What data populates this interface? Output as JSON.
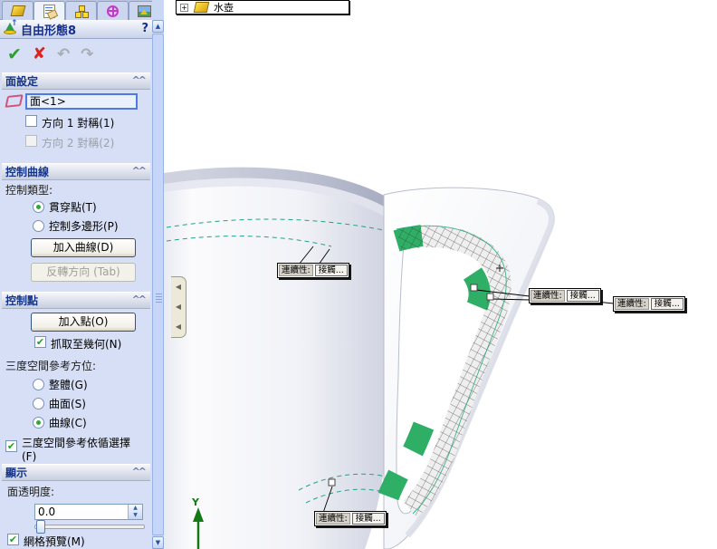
{
  "panel": {
    "tabs": [
      "feature-manager",
      "property-manager",
      "configuration-manager",
      "dimxpert-manager",
      "display-manager"
    ],
    "title": "自由形態8",
    "help": "?",
    "actions": {
      "ok": "✔",
      "cancel": "✘",
      "undo": "↶",
      "redo": "↷"
    },
    "face_settings": {
      "header": "面設定",
      "face_value": "面<1>",
      "dir1_symmetry": "方向 1 對稱(1)",
      "dir2_symmetry": "方向 2 對稱(2)"
    },
    "control_curves": {
      "header": "控制曲線",
      "control_type_label": "控制類型:",
      "through_points": "貫穿點(T)",
      "control_polygon": "控制多邊形(P)",
      "add_curve": "加入曲線(D)",
      "flip_direction": "反轉方向 (Tab)"
    },
    "control_points": {
      "header": "控制點",
      "add_point": "加入點(O)",
      "snap_to_geometry": "抓取至幾何(N)",
      "triad_label": "三度空間參考方位:",
      "global": "整體(G)",
      "surface": "曲面(S)",
      "curve": "曲線(C)",
      "follow_selection_line1": "三度空間參考依循選擇",
      "follow_selection_line2": "(F)"
    },
    "display": {
      "header": "顯示",
      "transparency_label": "面透明度:",
      "transparency_value": "0.0",
      "mesh_preview": "網格預覽(M)"
    }
  },
  "viewport": {
    "tree_item": "水壺",
    "tree_expander": "+",
    "callout": {
      "label": "連續性:",
      "value": "接觸..."
    },
    "axis_y": "Y"
  },
  "colors": {
    "panel_bg": "#d6dff5",
    "header_text": "#15358a",
    "selection_border": "#4f7ae0",
    "model_green": "#2fae66",
    "dashed_curve": "#22a08c",
    "axis_green": "#157a15"
  }
}
